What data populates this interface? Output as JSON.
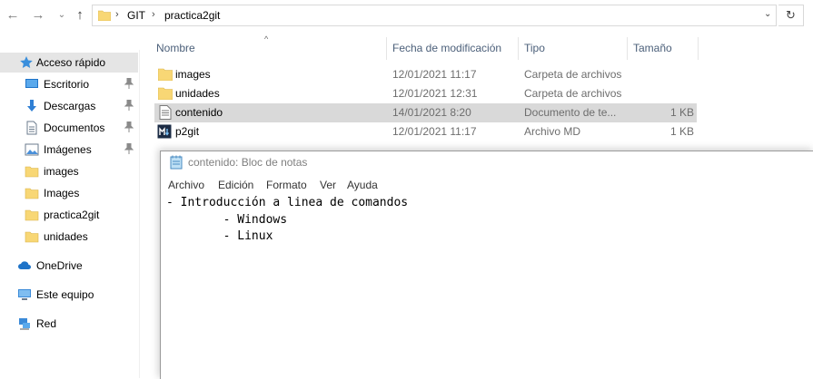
{
  "address_bar": {
    "crumbs": [
      "GIT",
      "practica2git"
    ],
    "separator": "›"
  },
  "columns": {
    "name": "Nombre",
    "modified": "Fecha de modificación",
    "type": "Tipo",
    "size": "Tamaño"
  },
  "sidebar": {
    "items": [
      {
        "label": "Acceso rápido",
        "icon": "star-icon",
        "pinned": false
      },
      {
        "label": "Escritorio",
        "icon": "desktop-icon",
        "pinned": true
      },
      {
        "label": "Descargas",
        "icon": "download-icon",
        "pinned": true
      },
      {
        "label": "Documentos",
        "icon": "documents-icon",
        "pinned": true
      },
      {
        "label": "Imágenes",
        "icon": "pictures-icon",
        "pinned": true
      },
      {
        "label": "images",
        "icon": "folder-icon",
        "pinned": false
      },
      {
        "label": "Images",
        "icon": "folder-icon",
        "pinned": false
      },
      {
        "label": "practica2git",
        "icon": "folder-icon",
        "pinned": false
      },
      {
        "label": "unidades",
        "icon": "folder-icon",
        "pinned": false
      },
      {
        "label": "OneDrive",
        "icon": "cloud-icon",
        "pinned": false
      },
      {
        "label": "Este equipo",
        "icon": "computer-icon",
        "pinned": false
      },
      {
        "label": "Red",
        "icon": "network-icon",
        "pinned": false
      }
    ]
  },
  "files": [
    {
      "name": "images",
      "modified": "12/01/2021 11:17",
      "type": "Carpeta de archivos",
      "size": "",
      "icon": "folder-icon"
    },
    {
      "name": "unidades",
      "modified": "12/01/2021 12:31",
      "type": "Carpeta de archivos",
      "size": "",
      "icon": "folder-icon"
    },
    {
      "name": "contenido",
      "modified": "14/01/2021 8:20",
      "type": "Documento de te...",
      "size": "1 KB",
      "icon": "text-file-icon"
    },
    {
      "name": "p2git",
      "modified": "12/01/2021 11:17",
      "type": "Archivo MD",
      "size": "1 KB",
      "icon": "markdown-file-icon"
    }
  ],
  "notepad": {
    "title": "contenido: Bloc de notas",
    "menu": [
      "Archivo",
      "Edición",
      "Formato",
      "Ver",
      "Ayuda"
    ],
    "content": "- Introducción a linea de comandos\n        - Windows\n        - Linux"
  },
  "colors": {
    "folder": "#f8d775",
    "selection": "#d9d9d9",
    "header_text": "#4c607a",
    "accent_blue": "#1e73c8"
  }
}
